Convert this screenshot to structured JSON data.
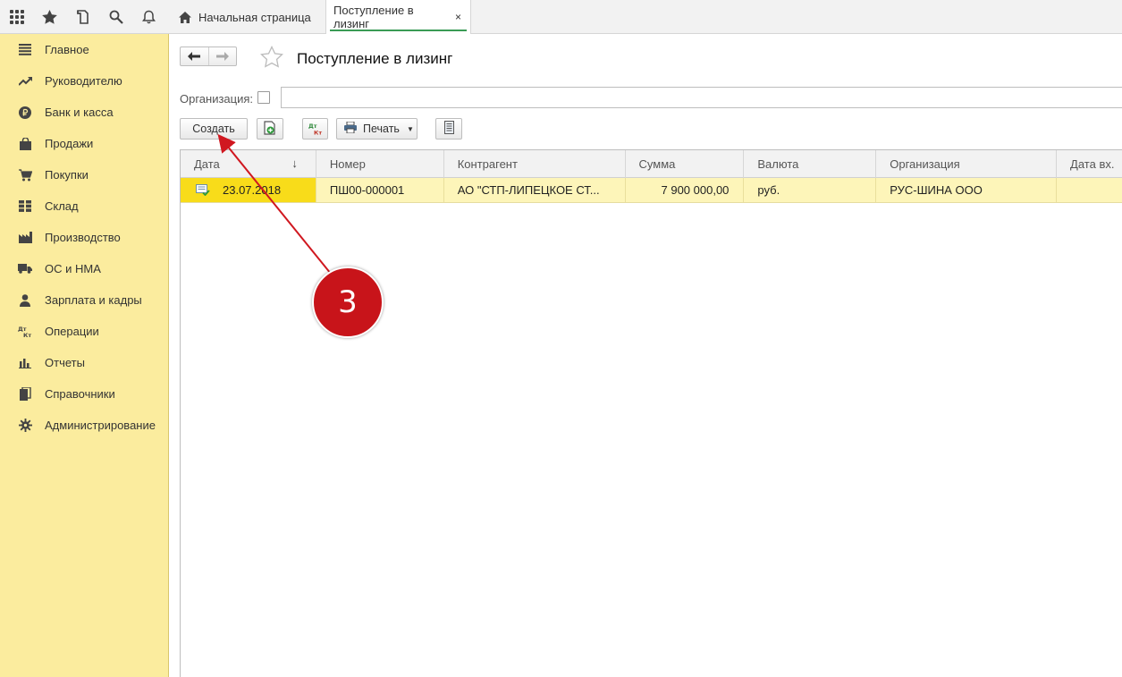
{
  "topbar": {
    "icons": [
      "apps-grid-icon",
      "favorites-star-icon",
      "history-icon",
      "search-icon",
      "notifications-bell-icon"
    ],
    "tabs": {
      "home_label": "Начальная страница",
      "active_label": "Поступление в лизинг",
      "close_glyph": "×"
    }
  },
  "sidebar": {
    "items": [
      {
        "label": "Главное",
        "icon": "menu-lines-icon"
      },
      {
        "label": "Руководителю",
        "icon": "trend-chart-icon"
      },
      {
        "label": "Банк и касса",
        "icon": "ruble-coin-icon"
      },
      {
        "label": "Продажи",
        "icon": "shopping-bag-icon"
      },
      {
        "label": "Покупки",
        "icon": "cart-icon"
      },
      {
        "label": "Склад",
        "icon": "warehouse-grid-icon"
      },
      {
        "label": "Производство",
        "icon": "factory-icon"
      },
      {
        "label": "ОС и НМА",
        "icon": "truck-icon"
      },
      {
        "label": "Зарплата и кадры",
        "icon": "person-icon"
      },
      {
        "label": "Операции",
        "icon": "dt-kt-icon",
        "icon_text": "ДтКт"
      },
      {
        "label": "Отчеты",
        "icon": "bar-chart-icon"
      },
      {
        "label": "Справочники",
        "icon": "books-icon"
      },
      {
        "label": "Администрирование",
        "icon": "gear-icon"
      }
    ]
  },
  "main": {
    "title": "Поступление в лизинг",
    "filter": {
      "organization_label": "Организация:",
      "organization_value": ""
    },
    "toolbar": {
      "create_label": "Создать",
      "dtkt_text": "ДтКт",
      "print_label": "Печать"
    },
    "table": {
      "columns": [
        "Дата",
        "Номер",
        "Контрагент",
        "Сумма",
        "Валюта",
        "Организация",
        "Дата вх."
      ],
      "sort_glyph": "↓",
      "rows": [
        {
          "date": "23.07.2018",
          "number": "ПШ00-000001",
          "counterparty": "АО \"СТП-ЛИПЕЦКОЕ СТ...",
          "amount": "7 900 000,00",
          "currency": "руб.",
          "organization": "РУС-ШИНА ООО",
          "incoming_date": ""
        }
      ]
    }
  },
  "annotation": {
    "step_number": "3"
  },
  "colors": {
    "sidebar_bg": "#fbec9e",
    "selected_cell": "#f8dc1a",
    "selected_row": "#fdf5b9",
    "active_tab_underline": "#3a9b55",
    "annotation_red": "#c8141a"
  }
}
